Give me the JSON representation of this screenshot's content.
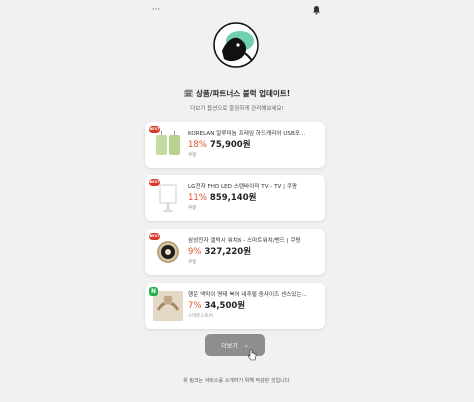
{
  "header": {
    "menu_icon": "more-dots-icon",
    "bell_icon": "bell-icon",
    "menu_glyph": "···",
    "bell_glyph": "🔔"
  },
  "headline": {
    "emoji": "🗓",
    "text": "상품/파트너스 블럭 업데이트!",
    "subtitle": "더보기 옵션으로 깔끔하게 관리해보세요!"
  },
  "products": [
    {
      "badge": "BEST",
      "title": "KORELAN 알루미늄 프레임 하드캐리어 USB포...",
      "discount": "18%",
      "price": "75,900원",
      "store": "쿠팡"
    },
    {
      "badge": "BEST",
      "title": "LG전자 FHD LED 스탠바이미 TV - TV | 쿠팡",
      "discount": "11%",
      "price": "859,140원",
      "store": "쿠팡"
    },
    {
      "badge": "BEST",
      "title": "삼성전자 갤럭시 워치6 - 스마트워치/밴드 | 쿠팡",
      "discount": "9%",
      "price": "327,220원",
      "store": "쿠팡"
    },
    {
      "badge": "N",
      "title": "행운 액막이 명태 북어 내추럴 중사이즈 센스있는...",
      "discount": "7%",
      "price": "34,500원",
      "store": "스마트스토어"
    }
  ],
  "more_button": {
    "label": "더보기",
    "icon": "chevron-down-icon",
    "glyph": "⌄"
  },
  "footer": {
    "text": "위 링크는 서비스를 소개하기 위해 작성된 것입니다."
  },
  "colors": {
    "discount": "#e0532b",
    "badge": "#d93a2a",
    "naver": "#21b14a",
    "button": "#8e8e90"
  }
}
